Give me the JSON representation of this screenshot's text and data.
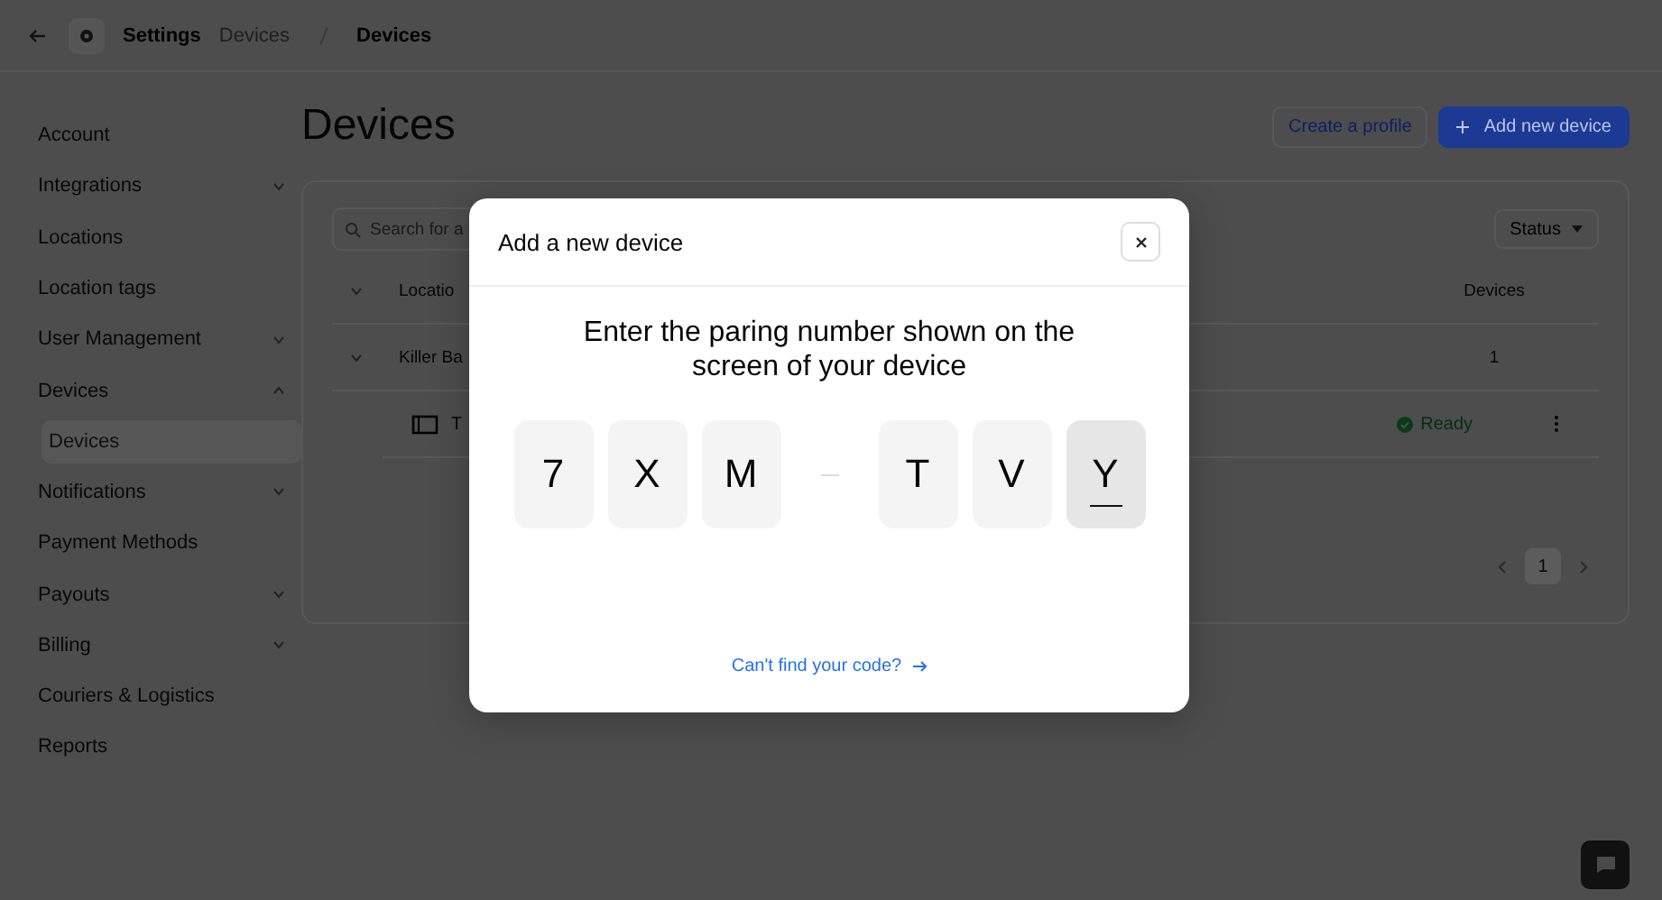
{
  "topbar": {
    "settings": "Settings",
    "breadcrumb": [
      "Devices",
      "Devices"
    ]
  },
  "sidebar": {
    "items": [
      {
        "label": "Account",
        "kind": "link"
      },
      {
        "label": "Integrations",
        "kind": "group",
        "expanded": false
      },
      {
        "label": "Locations",
        "kind": "link"
      },
      {
        "label": "Location tags",
        "kind": "link"
      },
      {
        "label": "User Management",
        "kind": "group",
        "expanded": false
      },
      {
        "label": "Devices",
        "kind": "group",
        "expanded": true,
        "children": [
          {
            "label": "Devices",
            "selected": true
          }
        ]
      },
      {
        "label": "Notifications",
        "kind": "group",
        "expanded": false
      },
      {
        "label": "Payment Methods",
        "kind": "link"
      },
      {
        "label": "Payouts",
        "kind": "group",
        "expanded": false
      },
      {
        "label": "Billing",
        "kind": "group",
        "expanded": false
      },
      {
        "label": "Couriers & Logistics",
        "kind": "link"
      },
      {
        "label": "Reports",
        "kind": "link"
      }
    ]
  },
  "page": {
    "title": "Devices",
    "buttons": [
      {
        "label": "Create a profile",
        "kind": "secondary"
      },
      {
        "label": "Add new device",
        "kind": "primary"
      }
    ]
  },
  "table": {
    "search": {
      "placeholder": "Search for a"
    },
    "filter": "Status",
    "columns": [
      "Locatio",
      "Devices"
    ],
    "rows": [
      {
        "name": "Killer Ba",
        "count": "1",
        "expanded": true,
        "children": [
          {
            "name": "T",
            "status": "Ready"
          }
        ]
      }
    ],
    "pages": [
      {
        "label": "1",
        "selected": true
      }
    ]
  },
  "modal": {
    "title": "Add a new device",
    "heading": "Enter the paring number shown on the screen of your device",
    "code": [
      {
        "char": "7",
        "selected": false
      },
      {
        "char": "X",
        "selected": false
      },
      {
        "char": "M",
        "selected": false
      },
      {
        "char": "T",
        "selected": false
      },
      {
        "char": "V",
        "selected": false
      },
      {
        "char": "Y",
        "selected": true
      }
    ],
    "link": "Can't find your code?"
  }
}
